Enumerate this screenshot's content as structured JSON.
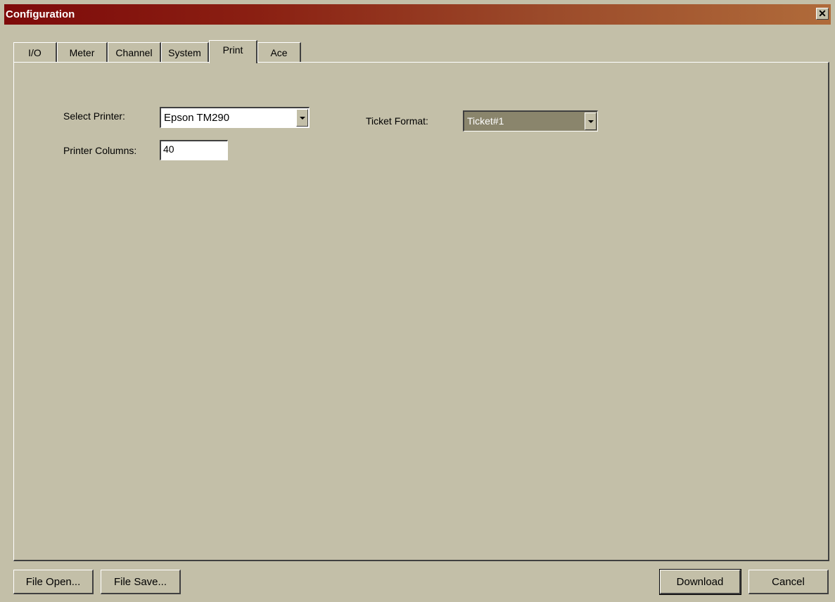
{
  "window": {
    "title": "Configuration",
    "close_symbol": "✕"
  },
  "tabs": [
    {
      "label": "I/O"
    },
    {
      "label": "Meter"
    },
    {
      "label": "Channel"
    },
    {
      "label": "System"
    },
    {
      "label": "Print"
    },
    {
      "label": "Ace"
    }
  ],
  "active_tab": "Print",
  "print": {
    "select_printer_label": "Select Printer:",
    "select_printer_value": "Epson TM290",
    "printer_columns_label": "Printer Columns:",
    "printer_columns_value": "40",
    "ticket_format_label": "Ticket Format:",
    "ticket_format_value": "Ticket#1"
  },
  "buttons": {
    "file_open": "File Open...",
    "file_save": "File Save...",
    "download": "Download",
    "cancel": "Cancel"
  },
  "colors": {
    "dialog_face": "#c3bfa8",
    "title_gradient_start": "#7e0a0a",
    "title_gradient_end": "#b06b3a",
    "disabled_combo": "#8a856c"
  },
  "icons": {
    "close": "close-icon",
    "dropdown": "chevron-down-icon"
  }
}
